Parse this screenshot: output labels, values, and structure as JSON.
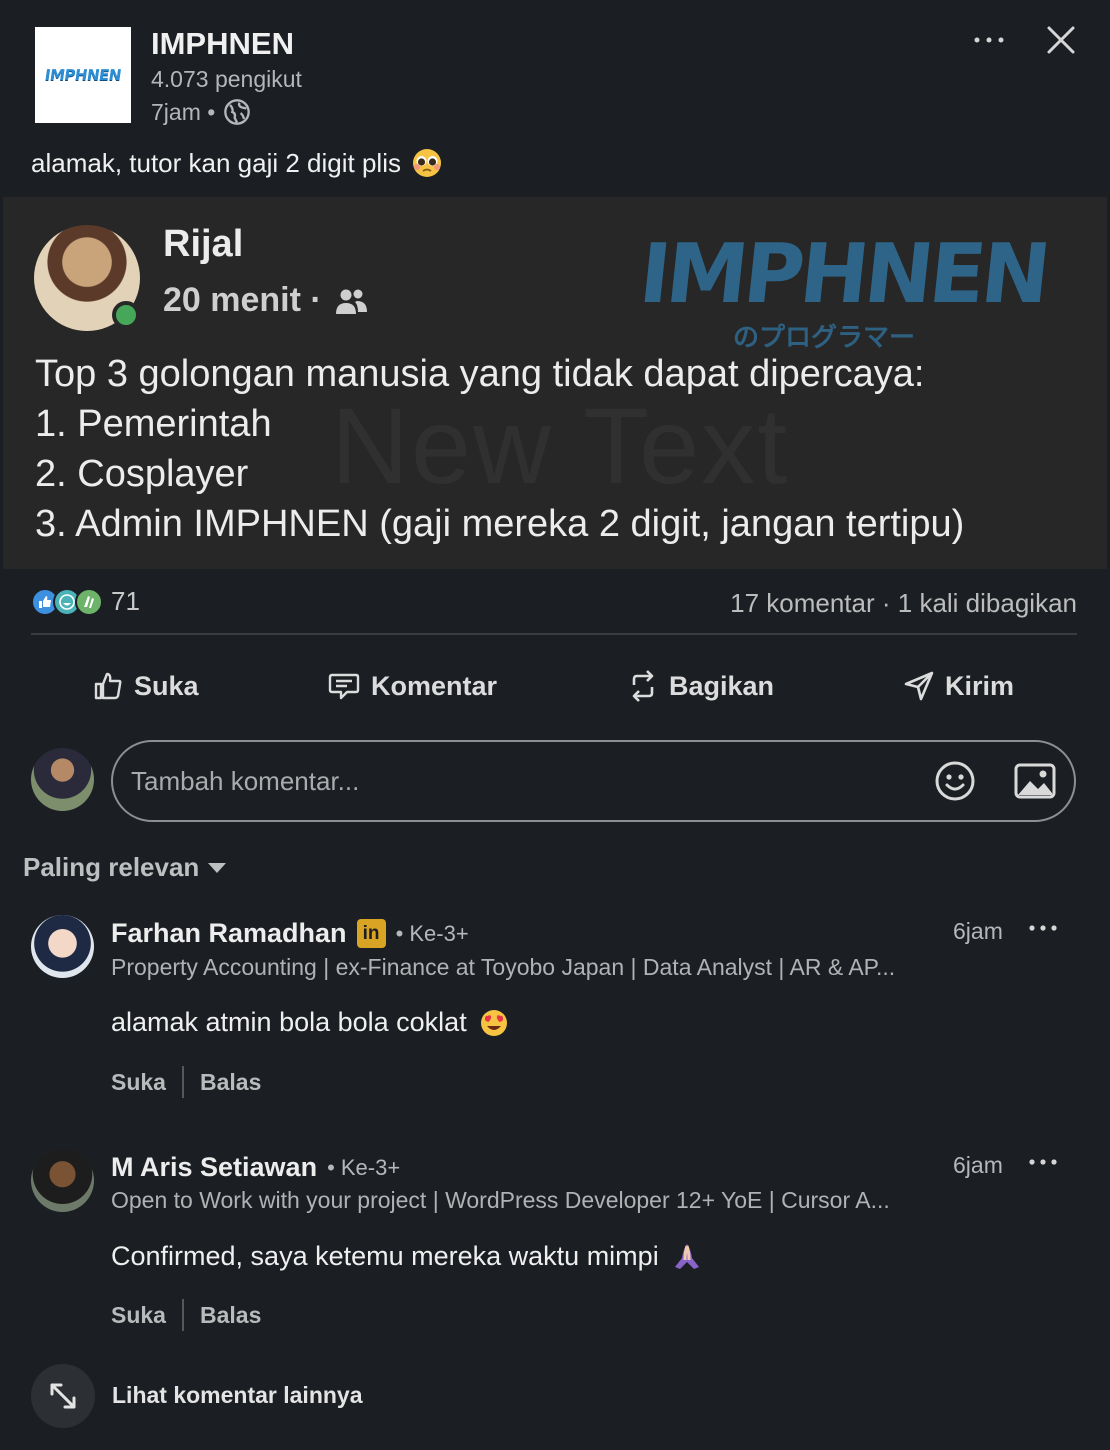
{
  "post": {
    "org_name": "IMPHNEN",
    "org_logo_text": "IMPHNEN",
    "followers": "4.073 pengikut",
    "time": "7jam •",
    "caption": "alamak, tutor kan gaji 2 digit plis"
  },
  "shared_image": {
    "author": "Rijal",
    "time": "20 menit ·",
    "watermark": "IMPHNEN",
    "watermark_sub": "のプログラマー",
    "overlay_text": "New Text",
    "lines": [
      "Top 3 golongan manusia yang tidak dapat dipercaya:",
      "1. Pemerintah",
      "2. Cosplayer",
      "3. Admin IMPHNEN (gaji mereka 2 digit, jangan tertipu)"
    ]
  },
  "stats": {
    "reaction_count": "71",
    "social_counts": "17 komentar · 1 kali dibagikan"
  },
  "actions": {
    "like": "Suka",
    "comment": "Komentar",
    "share": "Bagikan",
    "send": "Kirim"
  },
  "comment_input": {
    "placeholder": "Tambah komentar..."
  },
  "sort": {
    "label": "Paling relevan"
  },
  "comments": [
    {
      "name": "Farhan Ramadhan",
      "badge": "in",
      "degree": "• Ke-3+",
      "headline": "Property Accounting | ex-Finance at Toyobo Japan | Data Analyst | AR & AP...",
      "text": "alamak atmin bola bola coklat",
      "time": "6jam",
      "like": "Suka",
      "reply": "Balas"
    },
    {
      "name": "M Aris Setiawan",
      "degree": "• Ke-3+",
      "headline": "Open to Work with your project | WordPress Developer 12+ YoE | Cursor A...",
      "text": "Confirmed, saya ketemu mereka waktu mimpi",
      "time": "6jam",
      "like": "Suka",
      "reply": "Balas"
    }
  ],
  "more_comments": "Lihat komentar lainnya",
  "colors": {
    "background": "#1b1f23",
    "linkedin_badge": "#d9a324",
    "online": "#46a758"
  }
}
